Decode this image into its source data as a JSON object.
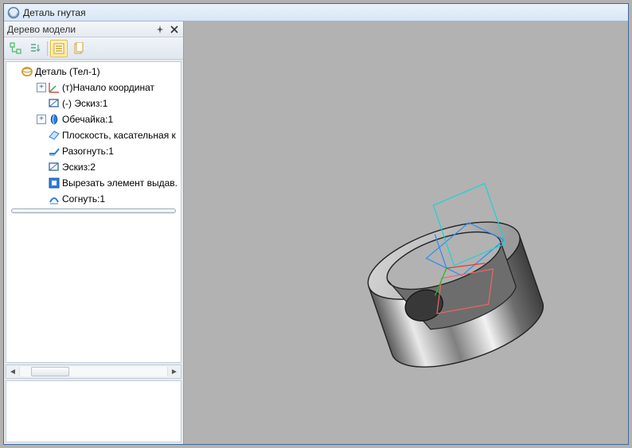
{
  "window": {
    "title": "Деталь гнутая"
  },
  "panel": {
    "title": "Дерево модели"
  },
  "toolbar": {
    "tool1": "tree-config",
    "tool2": "tree-sort",
    "sep": "|",
    "tool3": "list-view",
    "tool4": "doc-view"
  },
  "tree": {
    "root": {
      "label": "Деталь (Тел-1)"
    },
    "nodes": [
      {
        "expander": "+",
        "label": "(т)Начало координат",
        "icon": "origin-icon"
      },
      {
        "expander": "",
        "label": "(-) Эскиз:1",
        "icon": "sketch-icon"
      },
      {
        "expander": "+",
        "label": "Обечайка:1",
        "icon": "shell-icon"
      },
      {
        "expander": "",
        "label": "Плоскость, касательная к",
        "icon": "plane-icon"
      },
      {
        "expander": "",
        "label": "Разогнуть:1",
        "icon": "unbend-icon"
      },
      {
        "expander": "",
        "label": "Эскиз:2",
        "icon": "sketch-icon"
      },
      {
        "expander": "",
        "label": "Вырезать элемент выдав.",
        "icon": "cut-icon"
      },
      {
        "expander": "",
        "label": "Согнуть:1",
        "icon": "bend-icon"
      }
    ]
  }
}
